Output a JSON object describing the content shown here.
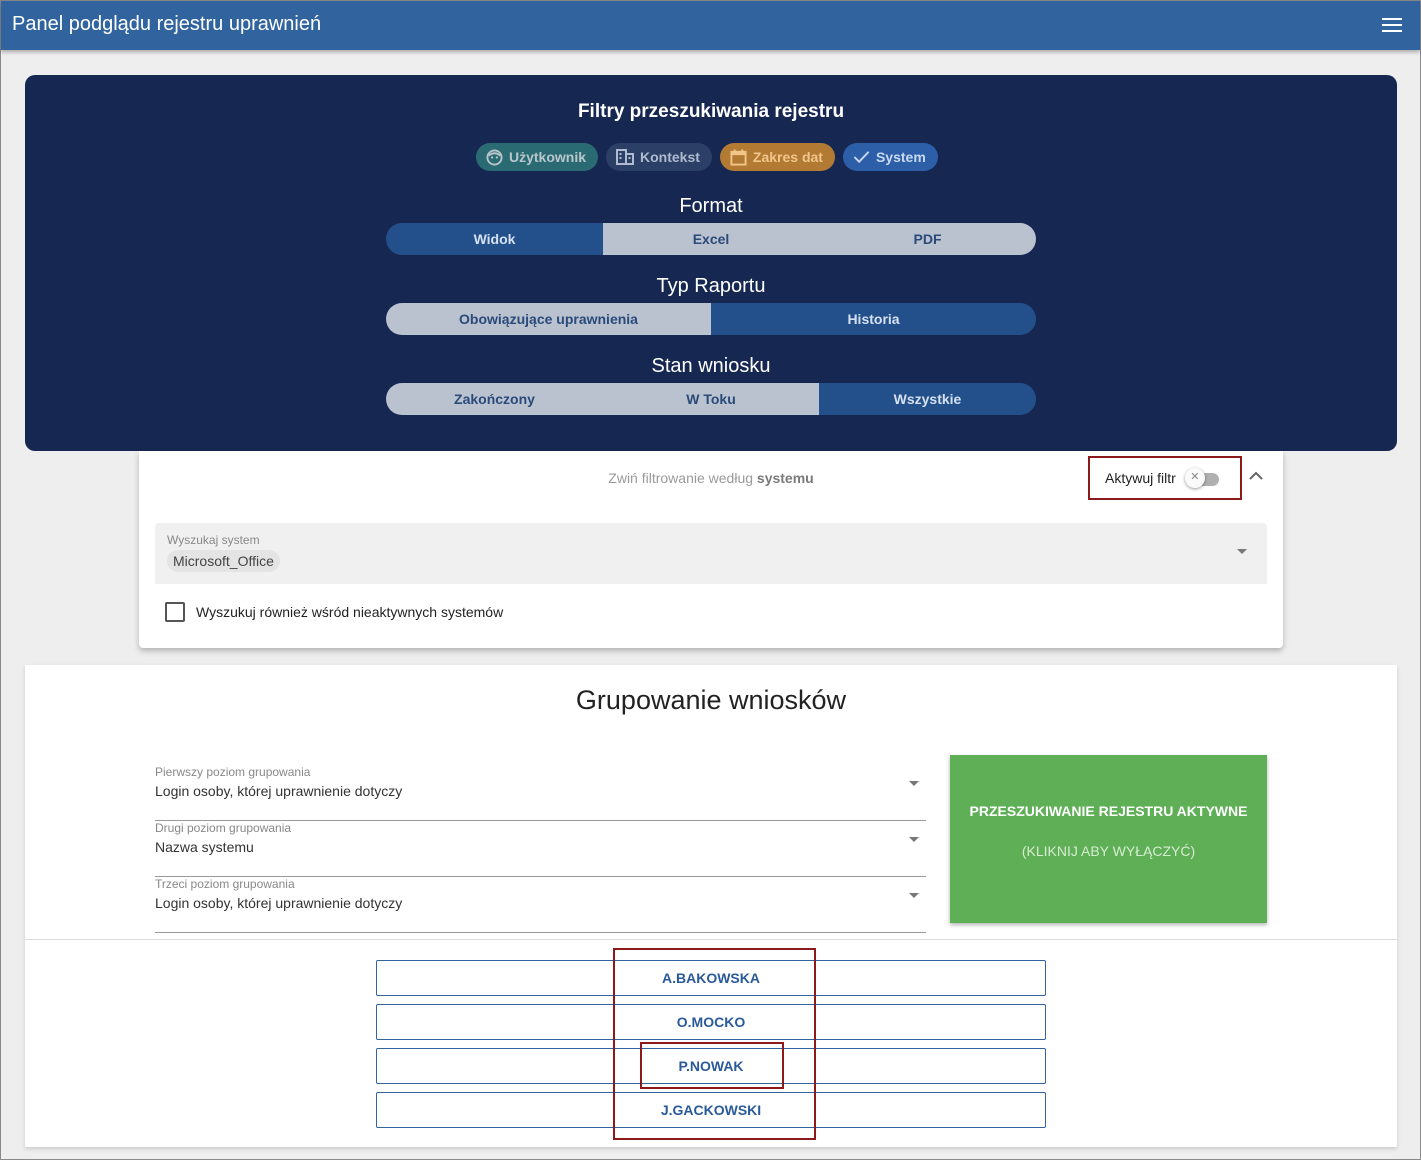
{
  "header": {
    "title": "Panel podglądu rejestru uprawnień"
  },
  "filters": {
    "title": "Filtry przeszukiwania rejestru",
    "chips": {
      "user": "Użytkownik",
      "context": "Kontekst",
      "dates": "Zakres dat",
      "system": "System"
    },
    "format": {
      "label": "Format",
      "options": [
        "Widok",
        "Excel",
        "PDF"
      ],
      "selected": "Widok"
    },
    "report_type": {
      "label": "Typ Raportu",
      "options": [
        "Obowiązujące uprawnienia",
        "Historia"
      ],
      "selected": "Historia"
    },
    "status": {
      "label": "Stan wniosku",
      "options": [
        "Zakończony",
        "W Toku",
        "Wszystkie"
      ],
      "selected": "Wszystkie"
    }
  },
  "system_filter": {
    "collapse_text": "Zwiń filtrowanie według ",
    "collapse_bold": "systemu",
    "activate_label": "Aktywuj filtr",
    "toggle_mark": "✕",
    "search_label": "Wyszukaj system",
    "search_value": "Microsoft_Office",
    "inactive_checkbox_label": "Wyszukuj również wśród nieaktywnych systemów"
  },
  "grouping": {
    "title": "Grupowanie wniosków",
    "levels": [
      {
        "label": "Pierwszy poziom grupowania",
        "value": "Login osoby, której uprawnienie dotyczy"
      },
      {
        "label": "Drugi poziom grupowania",
        "value": "Nazwa systemu"
      },
      {
        "label": "Trzeci poziom grupowania",
        "value": "Login osoby, której uprawnienie dotyczy"
      }
    ],
    "active_button": {
      "line1": "PRZESZUKIWANIE REJESTRU AKTYWNE",
      "line2": "(KLIKNIJ ABY WYŁĄCZYĆ)"
    },
    "users": [
      "A.BAKOWSKA",
      "O.MOCKO",
      "P.NOWAK",
      "J.GACKOWSKI"
    ]
  }
}
